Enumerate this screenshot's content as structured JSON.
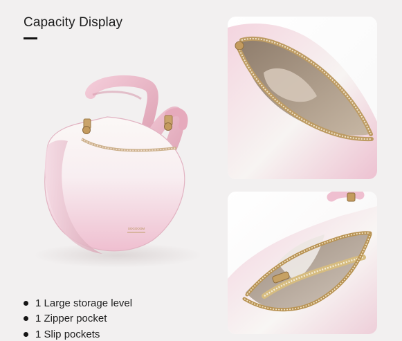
{
  "header": {
    "title": "Capacity Display"
  },
  "hero": {
    "brand_mark": "SOGOOOM"
  },
  "features": [
    "1 Large storage level",
    "1 Zipper pocket",
    "1 Slip pockets"
  ],
  "colors": {
    "background": "#f2f0f0",
    "bag_pink": "#e8b2c0",
    "bag_white": "#f7f4f2",
    "hardware_gold": "#b89356",
    "lining": "#b4a08c"
  },
  "icons": {
    "bullet": "bullet-dot-icon"
  }
}
